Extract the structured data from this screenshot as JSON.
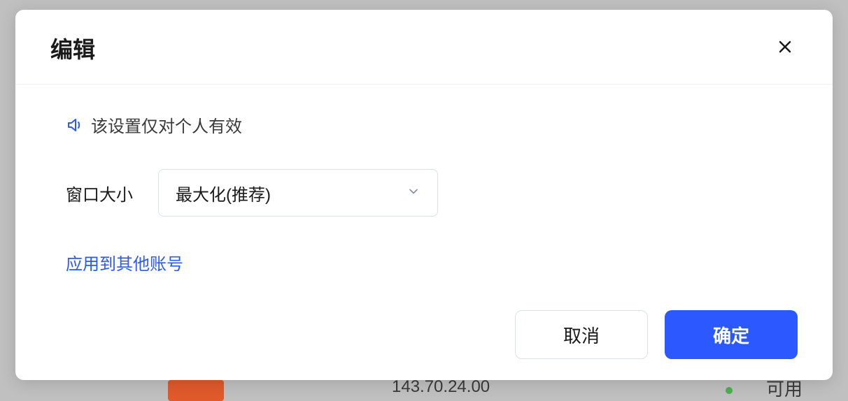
{
  "modal": {
    "title": "编辑",
    "notice_text": "该设置仅对个人有效",
    "form": {
      "window_size_label": "窗口大小",
      "window_size_value": "最大化(推荐)"
    },
    "apply_link": "应用到其他账号",
    "buttons": {
      "cancel": "取消",
      "confirm": "确定"
    }
  },
  "background": {
    "ip_fragment": "143.70.24.00",
    "status_text": "可用"
  }
}
